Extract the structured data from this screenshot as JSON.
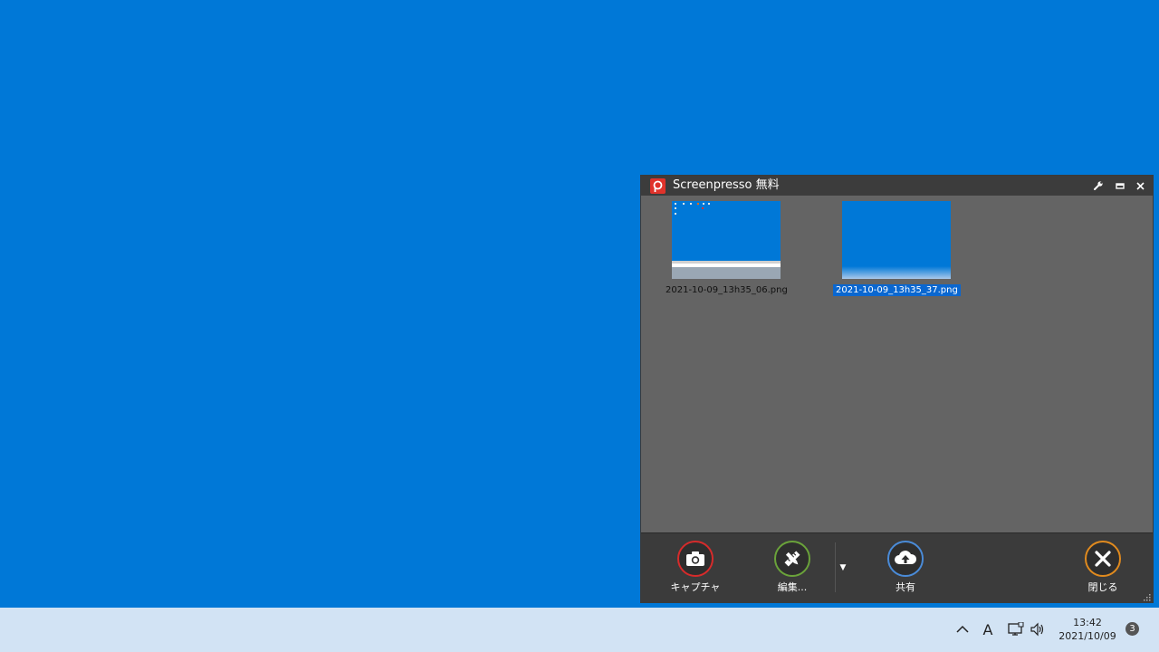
{
  "window": {
    "title": "Screenpresso 無料",
    "controls": [
      "wrench-icon",
      "minimize-icon",
      "close-icon"
    ]
  },
  "thumbnails": [
    {
      "filename": "2021-10-09_13h35_06.png",
      "selected": false
    },
    {
      "filename": "2021-10-09_13h35_37.png",
      "selected": true
    }
  ],
  "toolbar": {
    "capture_label": "キャプチャ",
    "edit_label": "編集...",
    "share_label": "共有",
    "close_label": "閉じる"
  },
  "colors": {
    "desktop": "#0078d7",
    "capture_ring": "#d62b2b",
    "edit_ring": "#6aa23a",
    "share_ring": "#4a8bd8",
    "close_ring": "#e08a1e",
    "selection": "#0a67d0"
  },
  "taskbar": {
    "ime_label": "A",
    "time": "13:42",
    "date": "2021/10/09",
    "notification_count": "3"
  }
}
